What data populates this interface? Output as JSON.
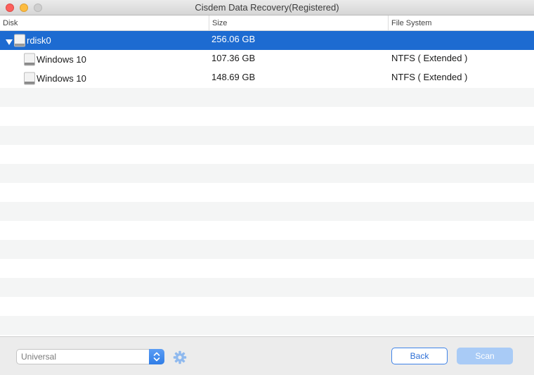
{
  "window": {
    "title": "Cisdem Data Recovery(Registered)"
  },
  "table": {
    "columns": {
      "disk": "Disk",
      "size": "Size",
      "file_system": "File System"
    },
    "rows": [
      {
        "name": "rdisk0",
        "size": "256.06 GB",
        "file_system": ""
      },
      {
        "name": "Windows 10",
        "size": "107.36 GB",
        "file_system": "NTFS ( Extended )"
      },
      {
        "name": "Windows 10",
        "size": "148.69 GB",
        "file_system": "NTFS ( Extended )"
      }
    ]
  },
  "footer": {
    "mode_select": {
      "value": "Universal"
    },
    "back_label": "Back",
    "scan_label": "Scan"
  },
  "colors": {
    "selection": "#1d6bd1",
    "accent": "#2f7de6",
    "scan_disabled": "#a9cbf6"
  },
  "icons": [
    "disclosure-triangle-icon",
    "hard-drive-icon",
    "chevron-updown-icon",
    "gear-icon"
  ]
}
